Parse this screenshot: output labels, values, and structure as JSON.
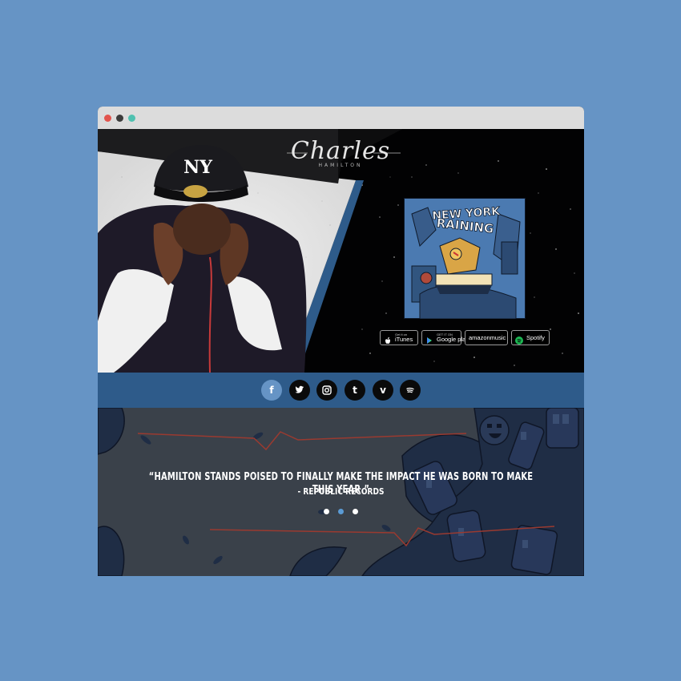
{
  "browser": {
    "dots": [
      {
        "name": "close",
        "color": "#e2544d"
      },
      {
        "name": "minimize",
        "color": "#3b3b3b"
      },
      {
        "name": "maximize",
        "color": "#4fc1b0"
      }
    ]
  },
  "header": {
    "logo_script": "Charles",
    "logo_sub": "HAMILTON"
  },
  "album": {
    "title_line1": "NEW YORK",
    "title_line2": "RAINING"
  },
  "stores": [
    {
      "small": "Get it on",
      "label": "iTunes",
      "icon": "apple-icon"
    },
    {
      "small": "GET IT ON",
      "label": "Google play",
      "icon": "google-play-icon"
    },
    {
      "small": "",
      "label": "amazonmusic",
      "icon": "amazon-icon"
    },
    {
      "small": "",
      "label": "Spotify",
      "icon": "spotify-icon"
    }
  ],
  "social": [
    {
      "name": "facebook",
      "glyph": "f",
      "icon": "facebook-icon",
      "active": true
    },
    {
      "name": "twitter",
      "glyph": "",
      "icon": "twitter-icon",
      "active": false
    },
    {
      "name": "instagram",
      "glyph": "",
      "icon": "instagram-icon",
      "active": false
    },
    {
      "name": "tumblr",
      "glyph": "t",
      "icon": "tumblr-icon",
      "active": false
    },
    {
      "name": "vimeo",
      "glyph": "v",
      "icon": "vimeo-icon",
      "active": false
    },
    {
      "name": "spotify",
      "glyph": "",
      "icon": "spotify-icon",
      "active": false
    }
  ],
  "testimonial": {
    "quote": "“HAMILTON STANDS POISED TO FINALLY MAKE THE IMPACT HE WAS BORN TO MAKE THIS YEAR.”",
    "source": "- REPUBLIC RECORDS",
    "active_index": 1,
    "count": 3
  },
  "colors": {
    "page_bg": "#6694c5",
    "accent_blue": "#2e5b8a",
    "quote_bg": "#3a414a",
    "active_dot": "#5b9bd5"
  }
}
